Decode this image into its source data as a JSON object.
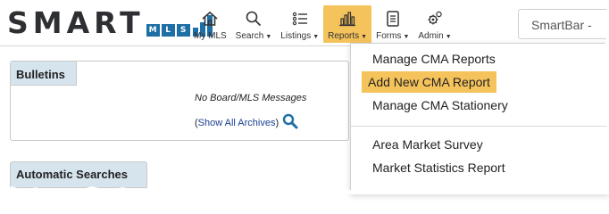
{
  "logo": {
    "word": "SMART",
    "mls_letters": [
      "M",
      "L",
      "S"
    ],
    "mls_colors": [
      "#1d6fa5",
      "#1d6fa5",
      "#1d6fa5"
    ]
  },
  "nav": {
    "items": [
      {
        "label": "My MLS",
        "icon": "home-icon",
        "caret": ""
      },
      {
        "label": "Search",
        "icon": "search-icon",
        "caret": "▼"
      },
      {
        "label": "Listings",
        "icon": "list-icon",
        "caret": "▼"
      },
      {
        "label": "Reports",
        "icon": "bar-chart-icon",
        "caret": "▼",
        "active": true
      },
      {
        "label": "Forms",
        "icon": "document-icon",
        "caret": "▼"
      },
      {
        "label": "Admin",
        "icon": "gears-icon",
        "caret": "▼"
      }
    ]
  },
  "smartbar": {
    "text": "SmartBar -"
  },
  "bulletins": {
    "title": "Bulletins",
    "message": "No Board/MLS Messages",
    "archive_open": "(",
    "archive_link": "Show All Archives",
    "archive_close": ")"
  },
  "automatic_searches": {
    "title": "Automatic Searches"
  },
  "reports_menu": {
    "items": [
      {
        "label": "Manage CMA Reports"
      },
      {
        "label": "Add New CMA Report",
        "highlighted": true
      },
      {
        "label": "Manage CMA Stationery"
      },
      {
        "label": "Area Market Survey"
      },
      {
        "label": "Market Statistics Report"
      }
    ]
  },
  "colors": {
    "accent": "#f5c35b",
    "panel_tab": "#d6e4ee",
    "brand_blue": "#1d6fa5",
    "link": "#1a3f8f"
  }
}
